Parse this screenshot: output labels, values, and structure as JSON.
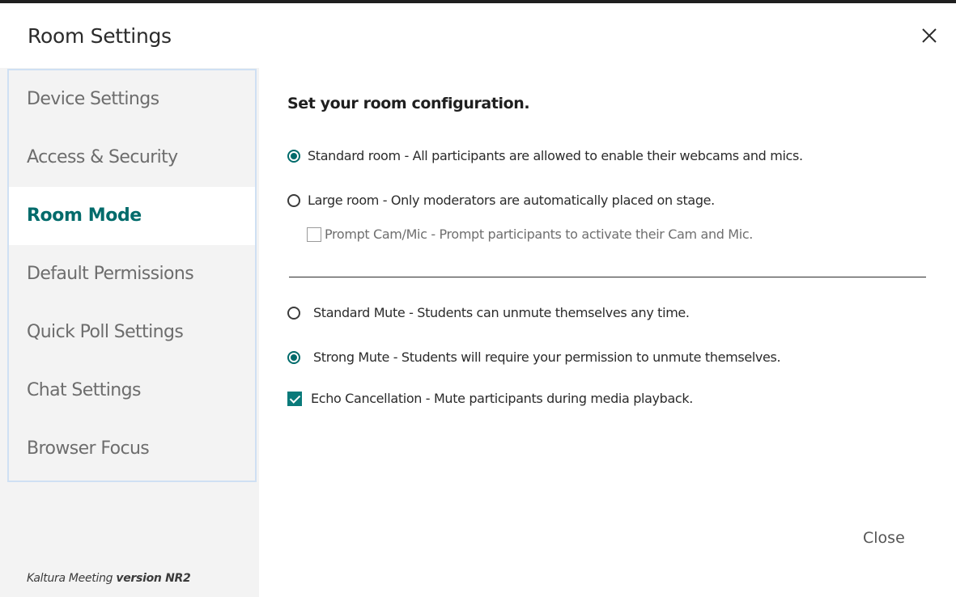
{
  "dialog": {
    "title": "Room Settings",
    "close_label": "Close",
    "version_prefix": "Kaltura Meeting",
    "version_value": "version NR2"
  },
  "sidebar": {
    "items": [
      {
        "label": "Device Settings",
        "active": false
      },
      {
        "label": "Access & Security",
        "active": false
      },
      {
        "label": "Room Mode",
        "active": true
      },
      {
        "label": "Default Permissions",
        "active": false
      },
      {
        "label": "Quick Poll Settings",
        "active": false
      },
      {
        "label": "Chat Settings",
        "active": false
      },
      {
        "label": "Browser Focus",
        "active": false
      }
    ]
  },
  "main": {
    "heading": "Set your room configuration.",
    "room_options": [
      {
        "label": "Standard room - All participants are allowed to enable their webcams and mics.",
        "selected": true
      },
      {
        "label": "Large room - Only moderators are automatically placed on stage.",
        "selected": false
      }
    ],
    "prompt_cam_mic": {
      "label": "Prompt Cam/Mic - Prompt participants to activate their Cam and Mic.",
      "checked": false
    },
    "mute_options": [
      {
        "label": "Standard Mute - Students can unmute themselves any time.",
        "selected": false
      },
      {
        "label": "Strong Mute - Students will require your permission to unmute themselves.",
        "selected": true
      }
    ],
    "echo_cancellation": {
      "label": "Echo Cancellation - Mute participants during media playback.",
      "checked": true
    }
  },
  "colors": {
    "accent": "#006b6b",
    "sidebar_bg": "#f3f3f3",
    "sidebar_border": "#cfe0f3"
  }
}
